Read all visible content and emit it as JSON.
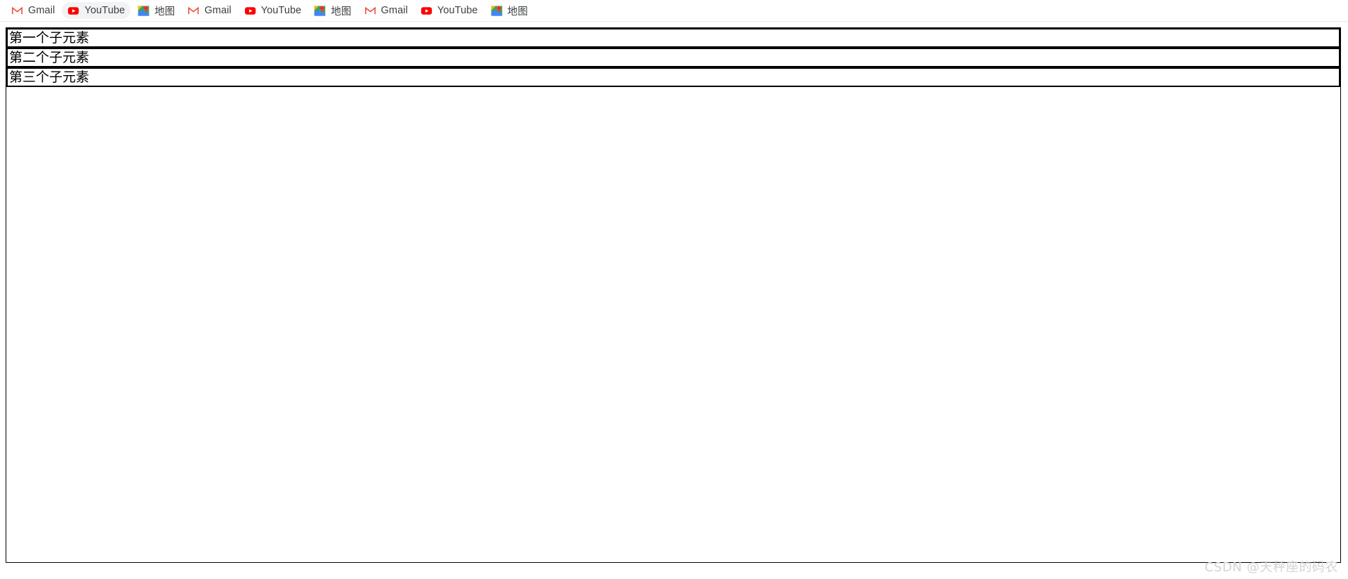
{
  "bookmarks_bar": {
    "items": [
      {
        "label": "Gmail",
        "icon": "gmail-icon",
        "hovered": false
      },
      {
        "label": "YouTube",
        "icon": "youtube-icon",
        "hovered": true
      },
      {
        "label": "地图",
        "icon": "maps-icon",
        "hovered": false
      },
      {
        "label": "Gmail",
        "icon": "gmail-icon",
        "hovered": false
      },
      {
        "label": "YouTube",
        "icon": "youtube-icon",
        "hovered": false
      },
      {
        "label": "地图",
        "icon": "maps-icon",
        "hovered": false
      },
      {
        "label": "Gmail",
        "icon": "gmail-icon",
        "hovered": false
      },
      {
        "label": "YouTube",
        "icon": "youtube-icon",
        "hovered": false
      },
      {
        "label": "地图",
        "icon": "maps-icon",
        "hovered": false
      }
    ]
  },
  "flex_container": {
    "items": [
      {
        "label": "第一个子元素"
      },
      {
        "label": "第二个子元素"
      },
      {
        "label": "第三个子元素"
      }
    ]
  },
  "watermark": {
    "text": "CSDN @天秤座的码农"
  },
  "colors": {
    "gmail_red": "#EA4335",
    "youtube_red": "#FF0000",
    "maps_green": "#34A853",
    "maps_blue": "#4285F4",
    "maps_yellow": "#FBBC04",
    "maps_pin_red": "#EA4335",
    "border_black": "#000000",
    "watermark_grey": "#D3D3D3",
    "text_grey": "#3C4043"
  }
}
